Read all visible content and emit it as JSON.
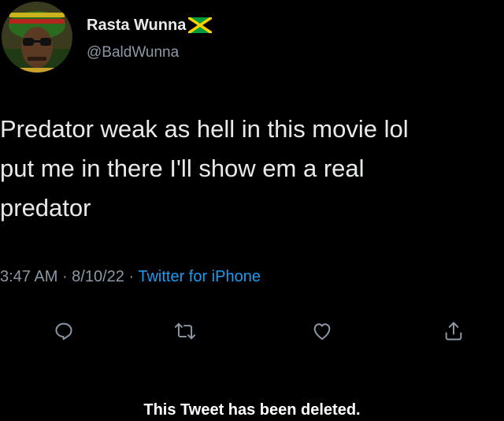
{
  "author": {
    "display_name": "Rasta Wunna",
    "handle": "@BaldWunna",
    "flag_icon": "jamaica-flag-icon",
    "avatar_icon": "user-avatar"
  },
  "tweet": {
    "lines": [
      "Predator weak as hell in this movie lol",
      "put me in there I'll show em a real",
      "predator"
    ]
  },
  "meta": {
    "time": "3:47 AM",
    "separator1": " · ",
    "date": "8/10/22",
    "separator2": " · ",
    "source": "Twitter for iPhone"
  },
  "actions": {
    "reply_icon": "reply-icon",
    "retweet_icon": "retweet-icon",
    "like_icon": "heart-icon",
    "share_icon": "share-icon"
  },
  "notice": {
    "text": "This Tweet has been deleted."
  },
  "colors": {
    "background": "#000000",
    "text_primary": "#e7e9ea",
    "text_secondary": "#8b98a5",
    "link": "#1d9bf0",
    "flag_green": "#009b3a",
    "flag_yellow": "#fed100"
  }
}
